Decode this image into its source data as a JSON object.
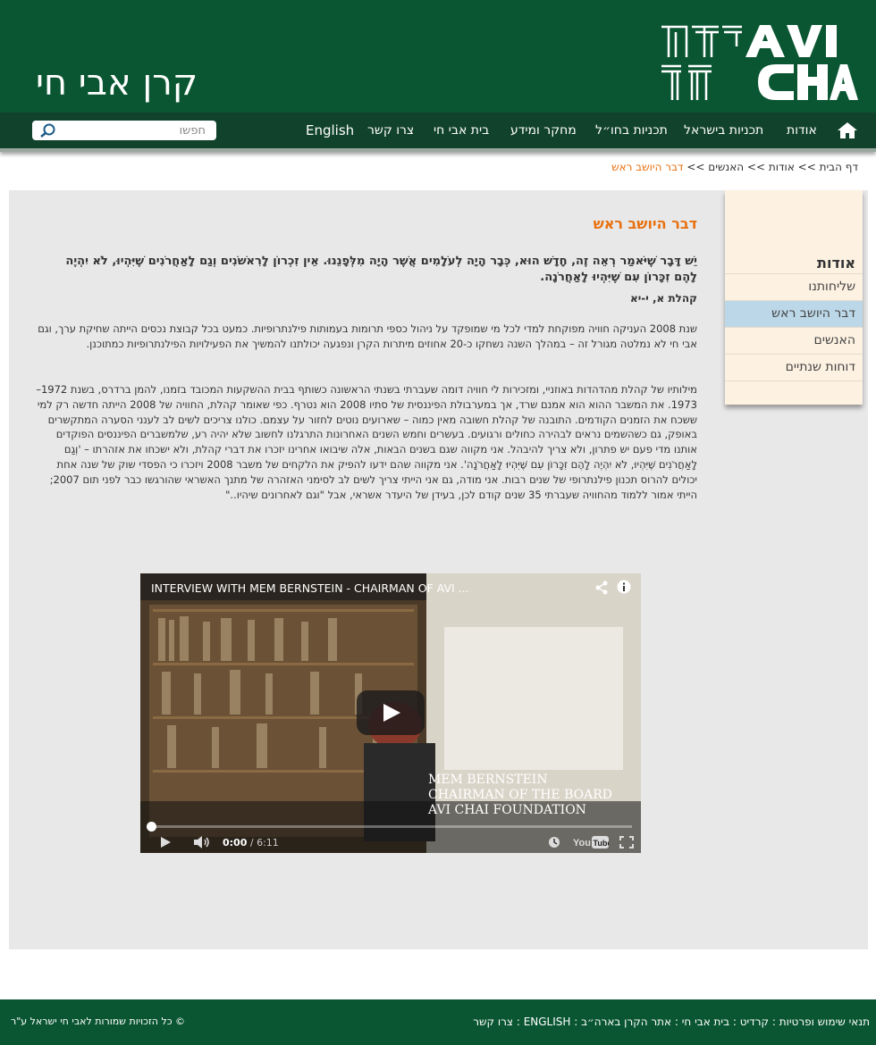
{
  "header": {
    "site_title": "קרן אבי חי",
    "logo_text_en": "AVI CHAI",
    "logo_text_he": "אבי חי"
  },
  "nav": {
    "items": [
      "אודות",
      "תכניות בישראל",
      "תכניות בחו״ל",
      "מחקר ומידע",
      "בית אבי חי",
      "צרו קשר",
      "English"
    ],
    "search_placeholder": "חפשו"
  },
  "breadcrumb": {
    "home": "דף הבית",
    "sep": ">>",
    "about": "אודות",
    "people": "האנשים",
    "current": "דבר היושב ראש"
  },
  "sidebar": {
    "heading": "אודות",
    "items": [
      "שליחותנו",
      "דבר היושב ראש",
      "האנשים",
      "דוחות שנתיים"
    ]
  },
  "content": {
    "title": "דבר היושב ראש",
    "quote": "יֵשׁ דָּבָר שֶׁיֹּאמַר רְאֵה זֶה, חָדָשׁ הוּא, כְּבָר הָיָה לְעֹלָמִים אֲשֶׁר הָיָה מִלְּפָנֵנוּ. אֵין זִכְרוֹן לָרִאשֹׁנִים וְגַם לָאַחֲרֹנִים שֶׁיִּהְיוּ, לֹא יִהְיֶה לָהֶם זִכָּרוֹן עִם שֶׁיִּהְיוּ לָאַחֲרֹנָה.",
    "quote_source": "קהלת א, י-יא",
    "para1": "שנת 2008 העניקה חוויה מפוקחת למדי לכל מי שמופקד על ניהול כספי תרומות בעמותות פילנתרופיות. כמעט בכל קבוצת נכסים הייתה שחיקת ערך, וגם אבי חי לא נמלטה מגורל זה – במהלך השנה נשחקו כ-20 אחוזים מיתרות הקרן ונפגעה יכולתנו להמשיך את הפעילויות הפילנתרופיות כמתוכנן.",
    "para2": "מילותיו של קהלת מהדהדות באוזניי, ומזכירות לי חוויה דומה שעברתי בשנתי הראשונה כשותף בבית ההשקעות המכובד בזמנו, להמן ברדרס, בשנת 1972–1973. את המשבר ההוא הוא אמנם שרד, אך במערבולת הפיננסית של סתיו 2008 הוא נטרף. כפי שאומר קהלת, החוויה של 2008 הייתה חדשה רק למי ששכח את הזמנים הקודמים. התובנה של קהלת חשובה מאין כמוה – שארועים נוטים לחזור על עצמם. כולנו צריכים לשים לב לענני הסערה המתקשרים באופק, גם כשהשמים נראים לבהירה כחולים ורגועים. בעשרים וחמש השנים האחרונות התרגלנו לחשוב שלא יהיה רע, שלמשברים הפיננסים הפוקדים אותנו מדי פעם יש פתרון, ולא צריך להיבהל. אני מקווה שגם בשנים הבאות, אלה שיבואו אחרינו יזכרו את דברי קהלת, ולא ישכחו את אזהרתו – 'וְגַם לָאַחֲרֹנִים שֶׁיִּהְיוּ, לֹא יִהְיֶה לָהֶם זִכָּרוֹן עִם שֶׁיִּהְיוּ לָאַחֲרֹנָה'. אני מקווה שהם ידעו להפיק את הלקחים של משבר 2008 ויזכרו כי הפסדי שוק של שנה אחת יכולים להרוס תכנון פילנתרופי של שנים רבות. אני מודה, גם אני הייתי צריך לשים לב לסימני האזהרה של מתנך האשראי שהורגשו כבר לפני תום 2007; הייתי אמור ללמוד מהחוויה שעברתי 35 שנים קודם לכן, בעידן של היעדר אשראי, אבל \"וגם לאחרונים שיהיו..\""
  },
  "video": {
    "title": "INTERVIEW WITH MEM BERNSTEIN - CHAIRMAN OF AVI ...",
    "caption_line1": "MEM BERNSTEIN",
    "caption_line2": "CHAIRMAN OF THE BOARD",
    "caption_line3": "AVI CHAI FOUNDATION",
    "time_current": "0:00",
    "time_total": "/ 6:11",
    "progress": 0
  },
  "footer": {
    "links": [
      "תנאי שימוש ופרטיות",
      "קרדיט",
      "בית אבי חי",
      "אתר הקרן בארה״ב",
      "ENGLISH",
      "צרו קשר"
    ],
    "separator": " : ",
    "copyright": "© כל הזכויות שמורות לאבי חי ישראל ע\"ר"
  }
}
